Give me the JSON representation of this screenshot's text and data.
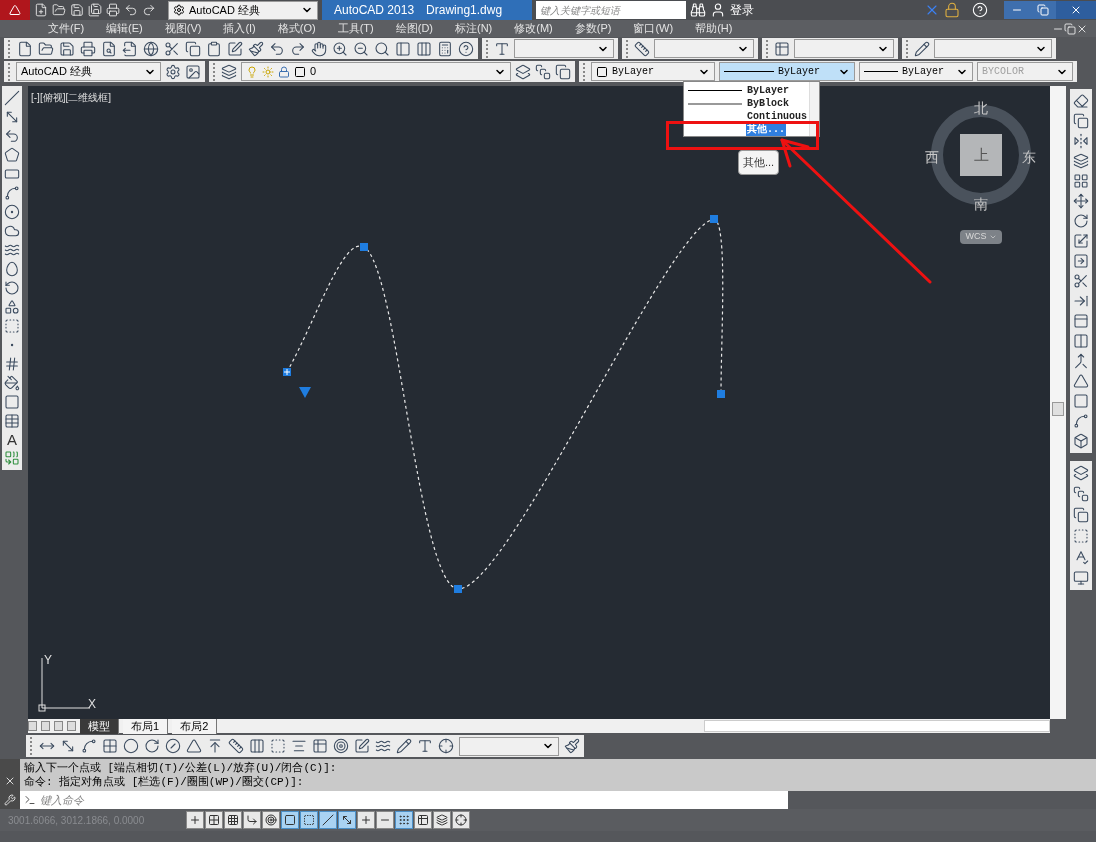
{
  "title_bar": {
    "workspace": "AutoCAD 经典",
    "app_title": "AutoCAD 2013",
    "document": "Drawing1.dwg",
    "search": {
      "placeholder": "键入关键字或短语"
    },
    "sign_in": "登录"
  },
  "menu_bar": [
    "文件(F)",
    "编辑(E)",
    "视图(V)",
    "插入(I)",
    "格式(O)",
    "工具(T)",
    "绘图(D)",
    "标注(N)",
    "修改(M)",
    "参数(P)",
    "窗口(W)",
    "帮助(H)"
  ],
  "layers_toolbar": {
    "workspace": "AutoCAD 经典",
    "layer": "0"
  },
  "properties_toolbar": {
    "color_setting": "ByLayer",
    "linetype": "ByLayer",
    "lineweight": "ByLayer",
    "plot_style": {
      "value": "BYCOLOR",
      "disabled": true
    }
  },
  "linetype_dropdown": {
    "expanded": true,
    "options": [
      {
        "label": "ByLayer",
        "kind": "solid",
        "selected": false
      },
      {
        "label": "ByBlock",
        "kind": "grey",
        "selected": false
      },
      {
        "label": "Continuous",
        "kind": "none",
        "selected": false
      },
      {
        "label": "其他...",
        "kind": "none",
        "selected": true
      }
    ]
  },
  "tooltip": "其他...",
  "draw_toolbar": {
    "text_tool": "A"
  },
  "viewport_label": "[-][俯视][二维线框]",
  "viewcube": {
    "north": "北",
    "south": "南",
    "east": "东",
    "west": "西",
    "top": "上",
    "ucs": "WCS"
  },
  "ucs_icon": {
    "x": "X",
    "y": "Y"
  },
  "layout_tabs": [
    {
      "label": "模型",
      "selected": true
    },
    {
      "label": "布局1",
      "selected": false
    },
    {
      "label": "布局2",
      "selected": false
    }
  ],
  "command_history": [
    "输入下一个点或 [端点相切(T)/公差(L)/放弃(U)/闭合(C)]:",
    "命令: 指定对角点或 [栏选(F)/圈围(WP)/圈交(CP)]:"
  ],
  "command_input": {
    "placeholder": "键入命令"
  },
  "status_bar": {
    "coordinates": "3001.6066, 3012.1866, 0.0000",
    "toggles": [
      {
        "on": false
      },
      {
        "on": false
      },
      {
        "on": false
      },
      {
        "on": false
      },
      {
        "on": false
      },
      {
        "on": true
      },
      {
        "on": true
      },
      {
        "on": true
      },
      {
        "on": true
      },
      {
        "on": false
      },
      {
        "on": false
      },
      {
        "on": true
      },
      {
        "on": false
      },
      {
        "on": false
      },
      {
        "on": false
      }
    ]
  }
}
